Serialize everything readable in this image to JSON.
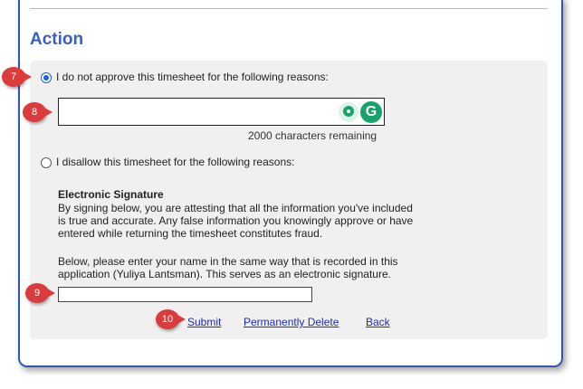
{
  "section": {
    "heading": "Action"
  },
  "options": {
    "not_approve_label": "I do not approve this timesheet for the following reasons:",
    "disallow_label": "I disallow this timesheet for the following reasons:"
  },
  "reason_input": {
    "value": "",
    "counter": "2000 characters remaining"
  },
  "grammarly": {
    "logo_letter": "G"
  },
  "signature": {
    "title": "Electronic Signature",
    "lines": [
      "By signing below, you are attesting that all the information you've included",
      "is true and accurate. Any false information you knowingly approve or have",
      "entered while returning the timesheet constitutes fraud."
    ],
    "instruction_lines": [
      "Below, please enter your name in the same way that is recorded in this",
      "application (Yuliya Lantsman). This serves as an electronic signature."
    ],
    "name_value": ""
  },
  "actions": {
    "submit": "Submit",
    "delete": "Permanently Delete",
    "back": "Back"
  },
  "callouts": [
    "7",
    "8",
    "9",
    "10"
  ],
  "colors": {
    "accent": "#3b5fc0",
    "callout": "#dc3b3b",
    "link": "#1b2db5",
    "grammarly": "#15a46c"
  }
}
